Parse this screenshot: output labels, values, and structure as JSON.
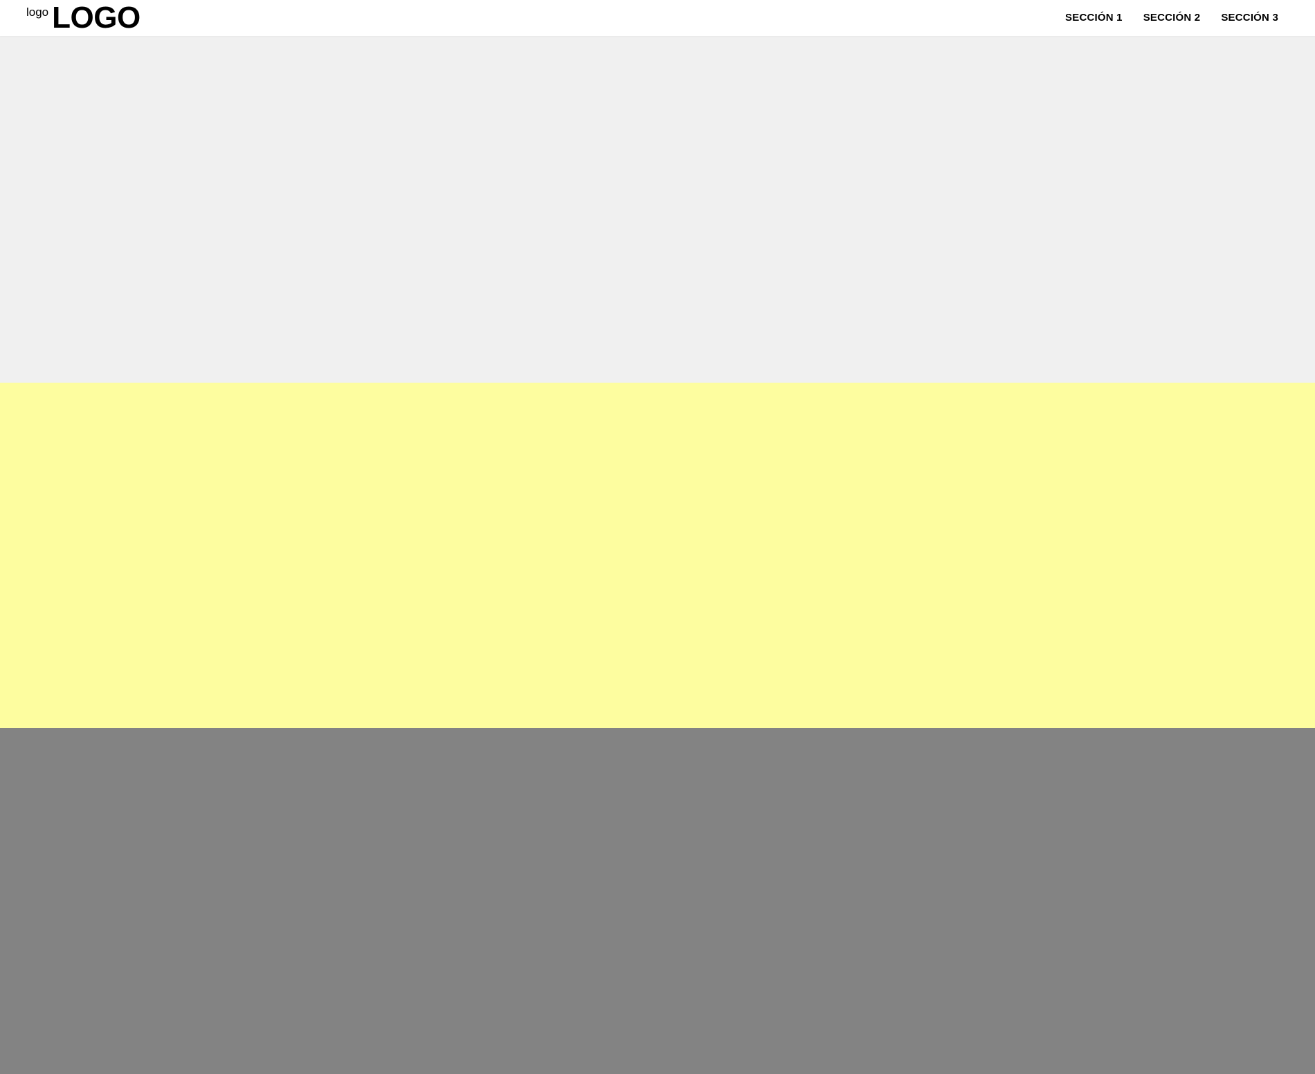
{
  "header": {
    "logo_alt": "logo",
    "logo_text": "LOGO",
    "nav": [
      {
        "label": "SECCIÓN 1"
      },
      {
        "label": "SECCIÓN 2"
      },
      {
        "label": "SECCIÓN 3"
      }
    ]
  },
  "sections": [
    {
      "color": "#f0f0f0"
    },
    {
      "color": "#fdfd9f"
    },
    {
      "color": "#838383"
    }
  ]
}
